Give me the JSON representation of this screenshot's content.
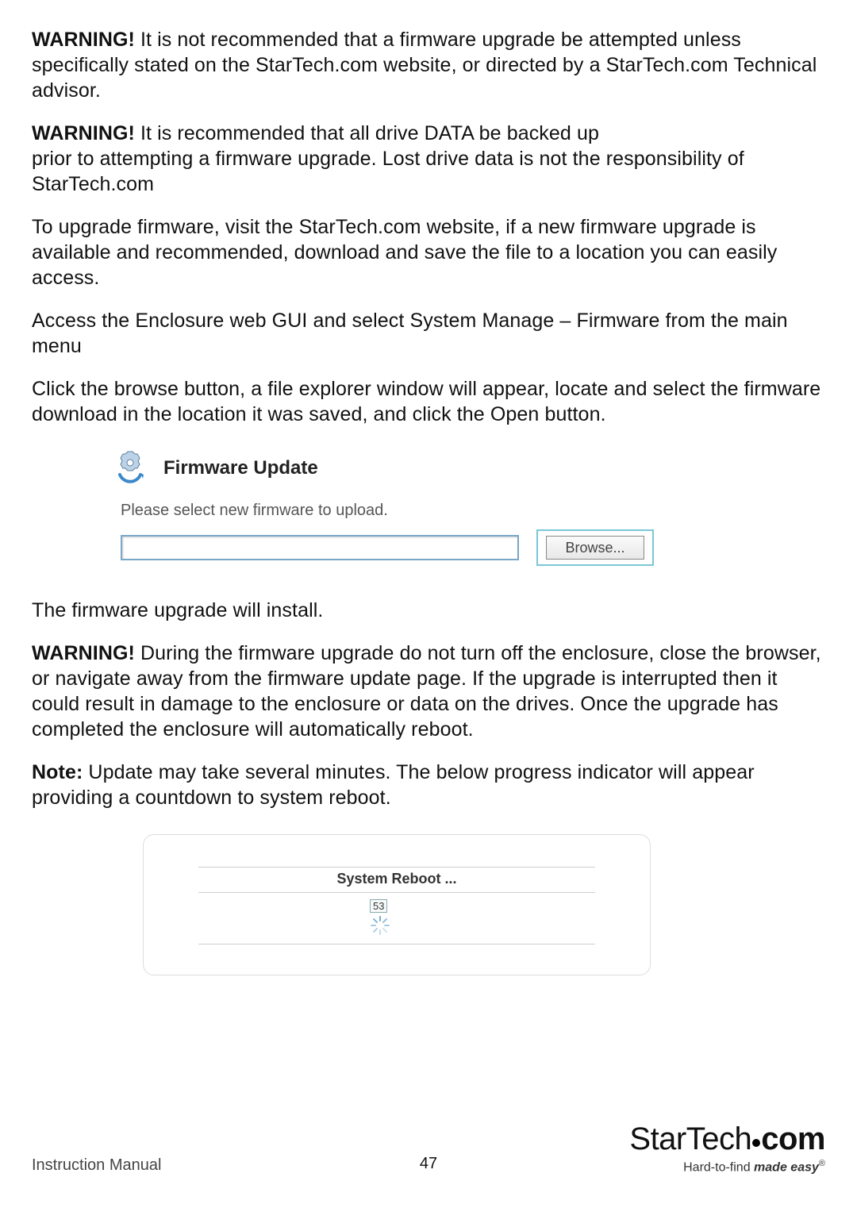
{
  "paragraphs": {
    "w1_bold": "WARNING!",
    "w1_text": " It is not recommended that a firmware upgrade be attempted unless specifically stated on the StarTech.com website, or directed by a StarTech.com Technical advisor.",
    "w2_bold": "WARNING!",
    "w2_line1": " It is recommended that all drive DATA be backed up",
    "w2_line2": "prior to attempting a firmware upgrade. Lost drive data is not the responsibility of StarTech.com",
    "p3": "To upgrade firmware, visit the StarTech.com website, if a new firmware upgrade is available and recommended, download and save the file to a location you can easily access.",
    "p4": "Access the Enclosure web GUI and select System Manage – Firmware from the main menu",
    "p5": "Click the browse button, a file explorer window will appear, locate and select the firmware download in the location it was saved, and click the Open button.",
    "p6": "The firmware upgrade will install.",
    "w3_bold": "WARNING!",
    "w3_text": " During the firmware upgrade do not turn off the enclosure, close the browser, or navigate away from the firmware update page.  If the upgrade is interrupted then it could result in damage to the enclosure or data on the drives. Once the upgrade has completed the enclosure will automatically reboot.",
    "note_bold": "Note:",
    "note_text": " Update may take several minutes. The below progress indicator will appear providing a countdown to system reboot."
  },
  "firmware_update": {
    "title": "Firmware Update",
    "label": "Please select new firmware to upload.",
    "input_value": "",
    "browse_label": "Browse..."
  },
  "system_reboot": {
    "title": "System Reboot ...",
    "countdown": "53"
  },
  "footer": {
    "left": "Instruction Manual",
    "page": "47",
    "brand_main": "StarTech",
    "brand_suffix": "com",
    "tagline_prefix": "Hard-to-find ",
    "tagline_em": "made easy",
    "tagline_reg": "®"
  }
}
